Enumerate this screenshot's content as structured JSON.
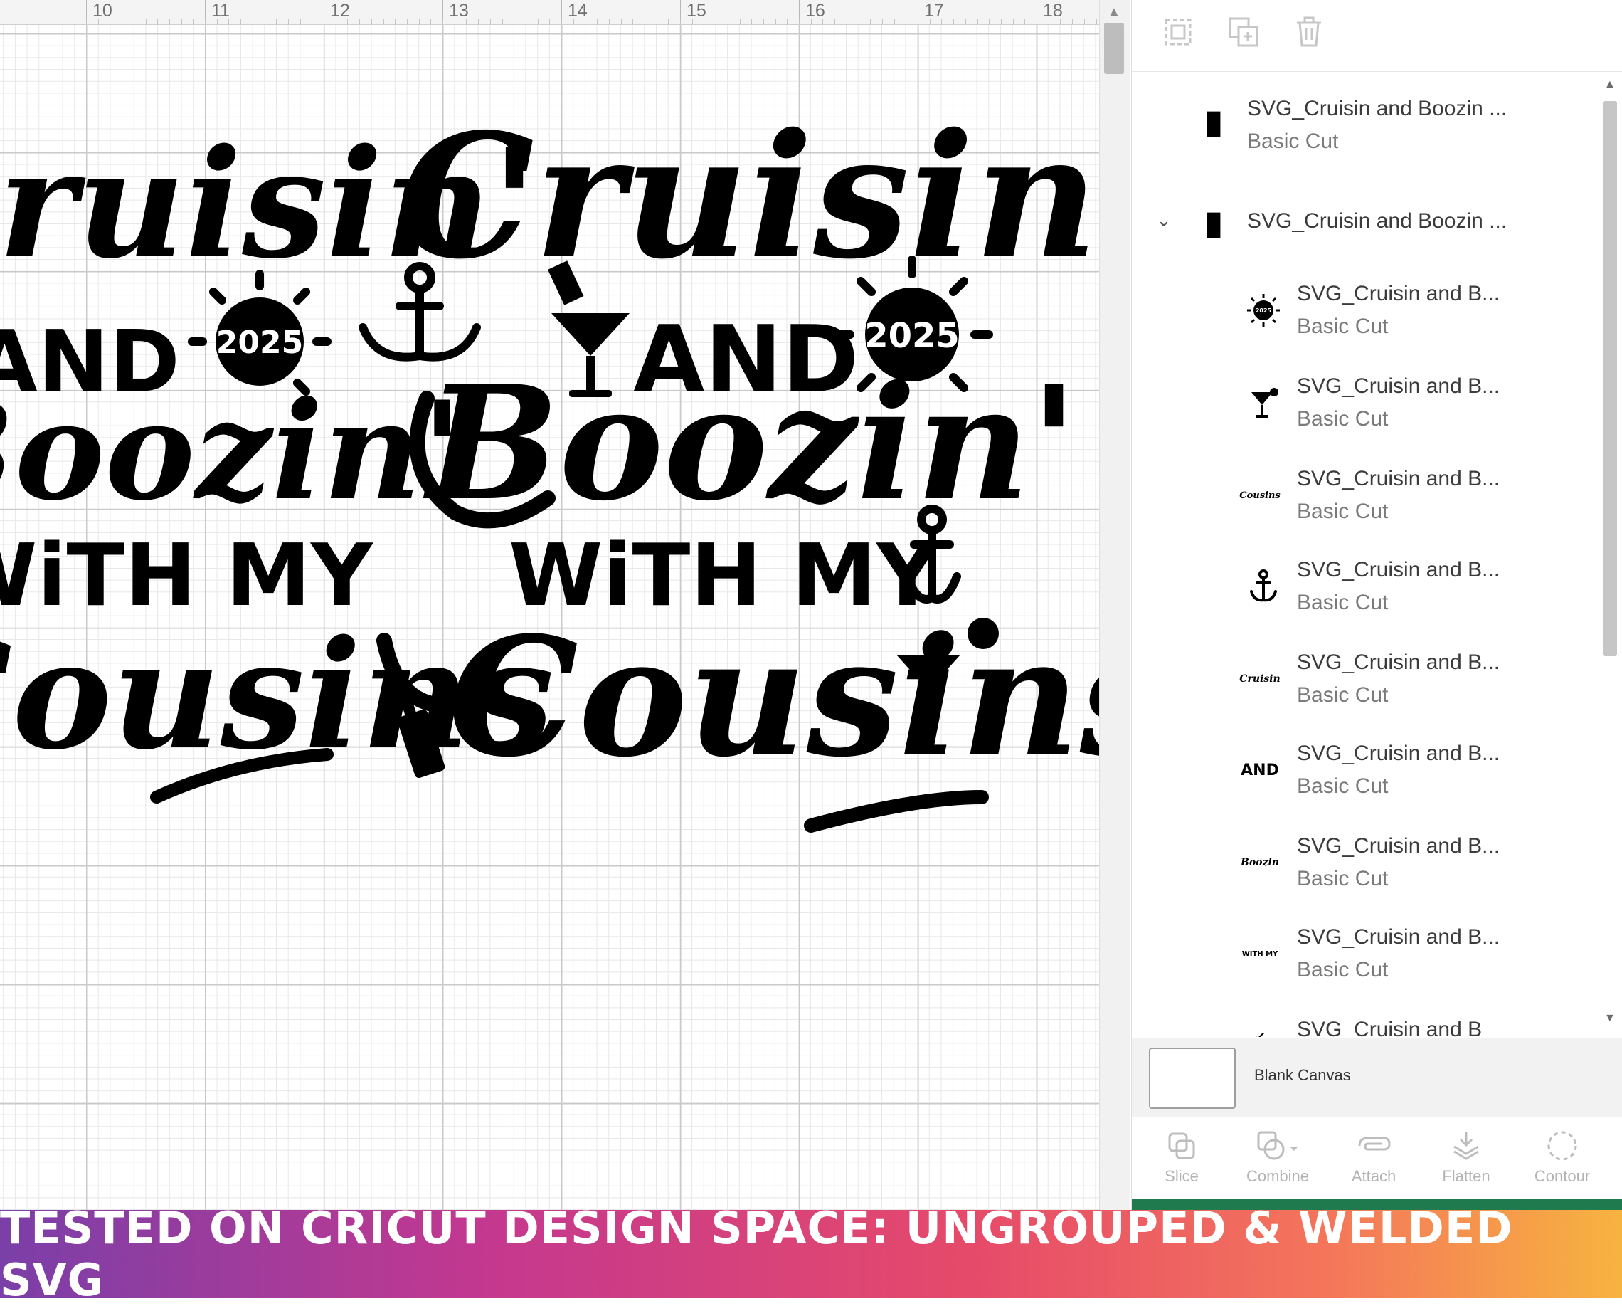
{
  "ruler": {
    "ticks": [
      "10",
      "11",
      "12",
      "13",
      "14",
      "15",
      "16",
      "17",
      "18"
    ]
  },
  "design": {
    "line1": "Cruisin'",
    "line2": "AND",
    "line3": "Boozin'",
    "line4": "WiTH MY",
    "line5": "Cousins",
    "year": "2025"
  },
  "panel": {
    "toolbar_icons": [
      "group-icon",
      "duplicate-icon",
      "delete-icon"
    ],
    "layers": [
      {
        "name": "SVG_Cruisin and Boozin ...",
        "sub": "Basic Cut",
        "thumb": "full-design-thumbnail"
      },
      {
        "name": "SVG_Cruisin and Boozin ...",
        "sub": "",
        "thumb": "full-design-thumbnail",
        "expanded": true
      },
      {
        "name": "SVG_Cruisin and B...",
        "sub": "Basic Cut",
        "thumb": "sun-2025",
        "thumb_text": "2025"
      },
      {
        "name": "SVG_Cruisin and B...",
        "sub": "Basic Cut",
        "thumb": "cocktail-glass"
      },
      {
        "name": "SVG_Cruisin and B...",
        "sub": "Basic Cut",
        "thumb": "cousins-text",
        "thumb_text": "Cousins"
      },
      {
        "name": "SVG_Cruisin and B...",
        "sub": "Basic Cut",
        "thumb": "anchor"
      },
      {
        "name": "SVG_Cruisin and B...",
        "sub": "Basic Cut",
        "thumb": "cruisin-text",
        "thumb_text": "Cruisin"
      },
      {
        "name": "SVG_Cruisin and B...",
        "sub": "Basic Cut",
        "thumb": "and-text",
        "thumb_text": "AND"
      },
      {
        "name": "SVG_Cruisin and B...",
        "sub": "Basic Cut",
        "thumb": "boozin-text",
        "thumb_text": "Boozin"
      },
      {
        "name": "SVG_Cruisin and B...",
        "sub": "Basic Cut",
        "thumb": "with-my-text",
        "thumb_text": "WITH MY"
      },
      {
        "name": "SVG_Cruisin and B",
        "sub": "",
        "thumb": "partial"
      }
    ],
    "blank_canvas_label": "Blank Canvas",
    "bottom_tools": [
      {
        "label": "Slice",
        "icon": "slice-icon"
      },
      {
        "label": "Combine",
        "icon": "combine-icon"
      },
      {
        "label": "Attach",
        "icon": "attach-icon"
      },
      {
        "label": "Flatten",
        "icon": "flatten-icon"
      },
      {
        "label": "Contour",
        "icon": "contour-icon"
      }
    ],
    "accent_color": "#1f7a4d"
  },
  "banner": {
    "text": "TESTED ON CRICUT DESIGN SPACE: UNGROUPED & WELDED SVG"
  }
}
